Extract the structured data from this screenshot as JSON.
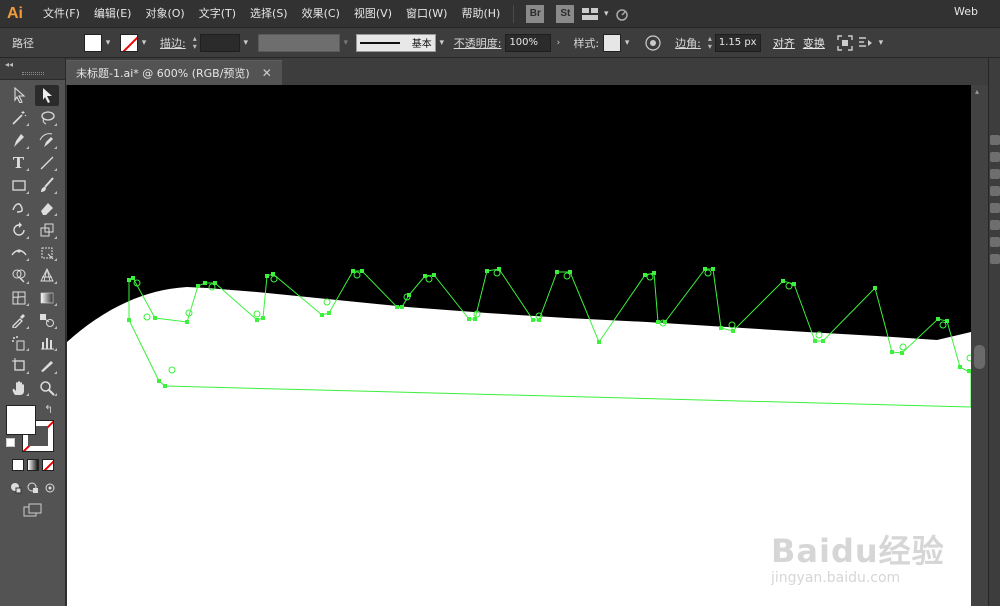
{
  "app": {
    "logo": "Ai"
  },
  "menu": {
    "items": [
      "文件(F)",
      "编辑(E)",
      "对象(O)",
      "文字(T)",
      "选择(S)",
      "效果(C)",
      "视图(V)",
      "窗口(W)",
      "帮助(H)"
    ],
    "bridge_label": "Br",
    "stock_label": "St",
    "workspace": "Web"
  },
  "control": {
    "object_type": "路径",
    "stroke_label": "描边:",
    "stroke_profile": "基本",
    "opacity_label": "不透明度:",
    "opacity_value": "100%",
    "style_label": "样式:",
    "corner_label": "边角:",
    "corner_value": "1.15 px",
    "align_label": "对齐",
    "transform_label": "变换"
  },
  "document": {
    "tab_title": "未标题-1.ai* @ 600% (RGB/预览)",
    "close_glyph": "✕"
  },
  "watermark": {
    "brand": "Baidu经验",
    "url": "jingyan.baidu.com"
  },
  "colors": {
    "accent_logo": "#f39a3b",
    "selection": "#3cf03c",
    "canvas_bg": "#000000",
    "shape_fill": "#ffffff"
  }
}
